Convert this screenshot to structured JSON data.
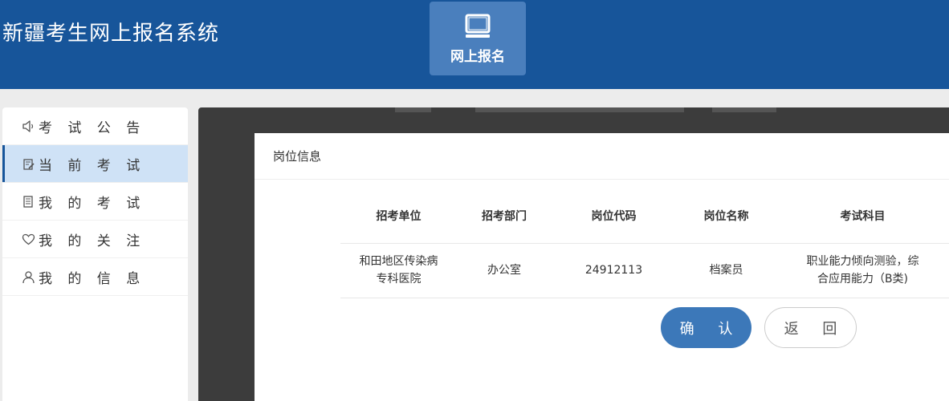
{
  "header": {
    "site_title": "新疆考生网上报名系统",
    "nav_tile": {
      "label": "网上报名",
      "icon": "monitor-icon"
    }
  },
  "sidebar": {
    "items": [
      {
        "label": "考 试 公 告",
        "icon": "speaker-icon",
        "active": false
      },
      {
        "label": "当 前 考 试",
        "icon": "edit-document-icon",
        "active": true
      },
      {
        "label": "我 的 考 试",
        "icon": "document-list-icon",
        "active": false
      },
      {
        "label": "我 的 关 注",
        "icon": "heart-icon",
        "active": false
      },
      {
        "label": "我 的 信 息",
        "icon": "user-icon",
        "active": false
      }
    ]
  },
  "modal": {
    "title": "岗位信息",
    "table": {
      "headers": [
        "招考单位",
        "招考部门",
        "岗位代码",
        "岗位名称",
        "考试科目"
      ],
      "rows": [
        [
          "和田地区传染病专科医院",
          "办公室",
          "24912113",
          "档案员",
          "职业能力倾向测验，综合应用能力（B类)"
        ]
      ]
    },
    "confirm_label": "确 认",
    "back_label": "返 回"
  },
  "colors": {
    "header_bg": "#17559a",
    "nav_tile_bg": "#4a7fbd",
    "active_item_bg": "#cfe2f6",
    "primary_button": "#3c78b9",
    "overlay": "#3c3c3c"
  }
}
